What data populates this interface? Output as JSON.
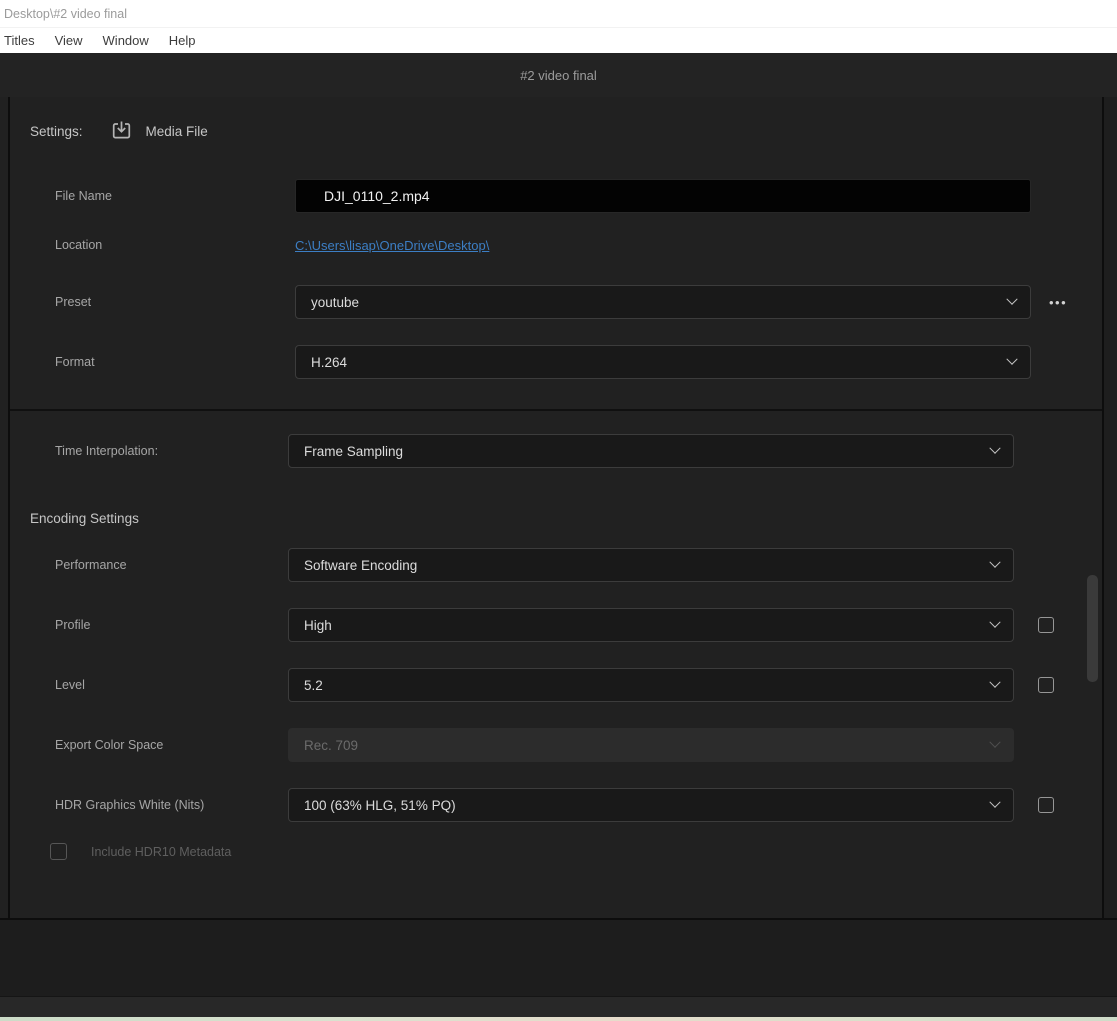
{
  "window": {
    "title": "Desktop\\#2 video final",
    "menu_items": [
      "Titles",
      "View",
      "Window",
      "Help"
    ],
    "header_title": "#2 video final"
  },
  "settings_header": {
    "label": "Settings:",
    "icon": "export-media-icon",
    "target_label": "Media File"
  },
  "fields": {
    "file_name": {
      "label": "File Name",
      "value": "DJI_0110_2.mp4"
    },
    "location": {
      "label": "Location",
      "value": "C:\\Users\\lisap\\OneDrive\\Desktop\\"
    },
    "preset": {
      "label": "Preset",
      "value": "youtube"
    },
    "format": {
      "label": "Format",
      "value": "H.264"
    },
    "time_interpolation": {
      "label": "Time Interpolation:",
      "value": "Frame Sampling"
    }
  },
  "encoding": {
    "section_title": "Encoding Settings",
    "performance": {
      "label": "Performance",
      "value": "Software Encoding"
    },
    "profile": {
      "label": "Profile",
      "value": "High",
      "checked": false
    },
    "level": {
      "label": "Level",
      "value": "5.2",
      "checked": false
    },
    "export_color_space": {
      "label": "Export Color Space",
      "value": "Rec. 709",
      "disabled": true
    },
    "hdr_graphics_white": {
      "label": "HDR Graphics White (Nits)",
      "value": "100 (63% HLG, 51% PQ)",
      "checked": false
    },
    "include_hdr10": {
      "label": "Include HDR10 Metadata",
      "checked": false,
      "disabled": true
    }
  },
  "icons": {
    "more_options": "•••"
  },
  "colors": {
    "link_blue": "#3c7ec4",
    "panel_bg": "#212121",
    "header_bg": "#232323"
  }
}
